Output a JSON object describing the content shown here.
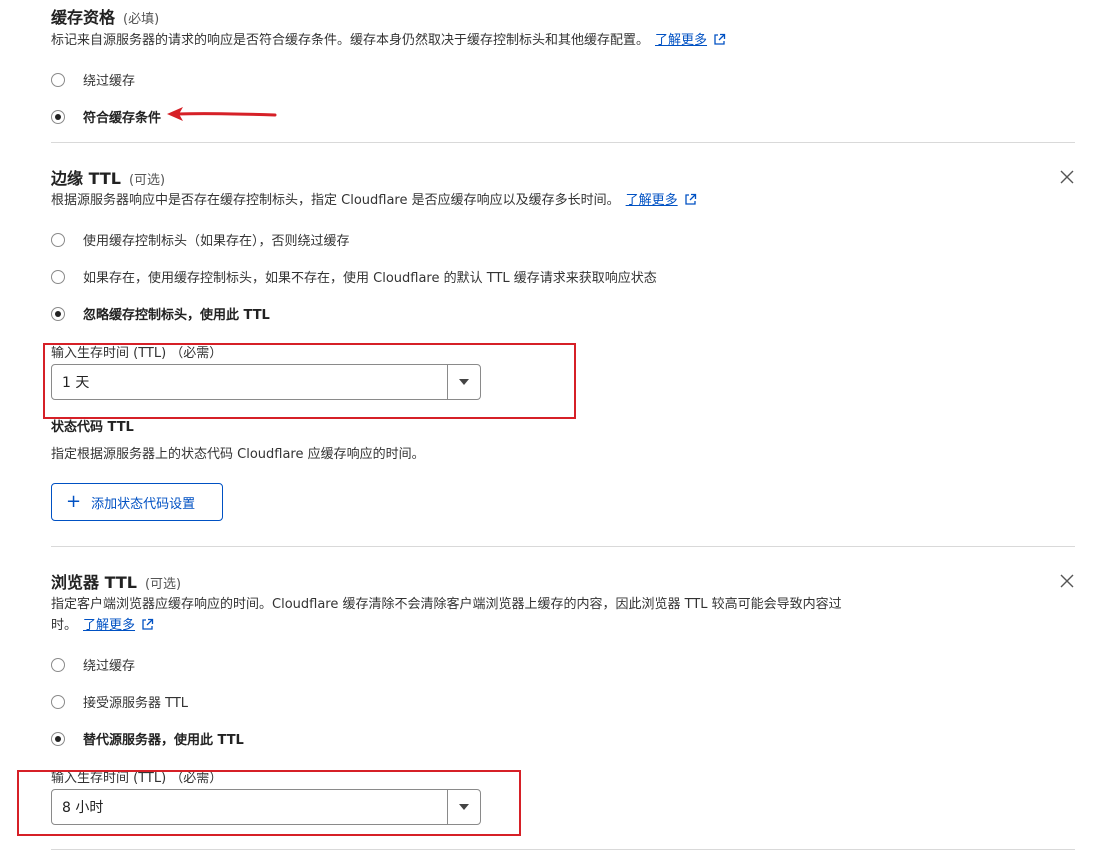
{
  "cache_eligibility": {
    "title": "缓存资格",
    "tag": "(必填)",
    "description": "标记来自源服务器的请求的响应是否符合缓存条件。缓存本身仍然取决于缓存控制标头和其他缓存配置。",
    "learn_more": "了解更多",
    "options": [
      {
        "label": "绕过缓存",
        "selected": false
      },
      {
        "label": "符合缓存条件",
        "selected": true
      }
    ]
  },
  "edge_ttl": {
    "title": "边缘 TTL",
    "tag": "(可选)",
    "description": "根据源服务器响应中是否存在缓存控制标头，指定 Cloudflare 是否应缓存响应以及缓存多长时间。",
    "learn_more": "了解更多",
    "options": [
      {
        "label": "使用缓存控制标头（如果存在），否则绕过缓存",
        "selected": false
      },
      {
        "label": "如果存在，使用缓存控制标头，如果不存在，使用 Cloudflare 的默认 TTL 缓存请求来获取响应状态",
        "selected": false
      },
      {
        "label": "忽略缓存控制标头，使用此 TTL",
        "selected": true
      }
    ],
    "ttl_label": "输入生存时间 (TTL) （必需）",
    "ttl_value": "1 天",
    "status_code_title": "状态代码 TTL",
    "status_code_desc": "指定根据源服务器上的状态代码 Cloudflare 应缓存响应的时间。",
    "add_button": "添加状态代码设置"
  },
  "browser_ttl": {
    "title": "浏览器 TTL",
    "tag": "(可选)",
    "description_line1": "指定客户端浏览器应缓存响应的时间。Cloudflare 缓存清除不会清除客户端浏览器上缓存的内容，因此浏览器 TTL 较高可能会导致内容过",
    "description_line2": "时。",
    "learn_more": "了解更多",
    "options": [
      {
        "label": "绕过缓存",
        "selected": false
      },
      {
        "label": "接受源服务器 TTL",
        "selected": false
      },
      {
        "label": "替代源服务器，使用此 TTL",
        "selected": true
      }
    ],
    "ttl_label": "输入生存时间 (TTL) （必需）",
    "ttl_value": "8 小时"
  },
  "colors": {
    "link": "#0051c3",
    "annotation": "#d62027"
  }
}
